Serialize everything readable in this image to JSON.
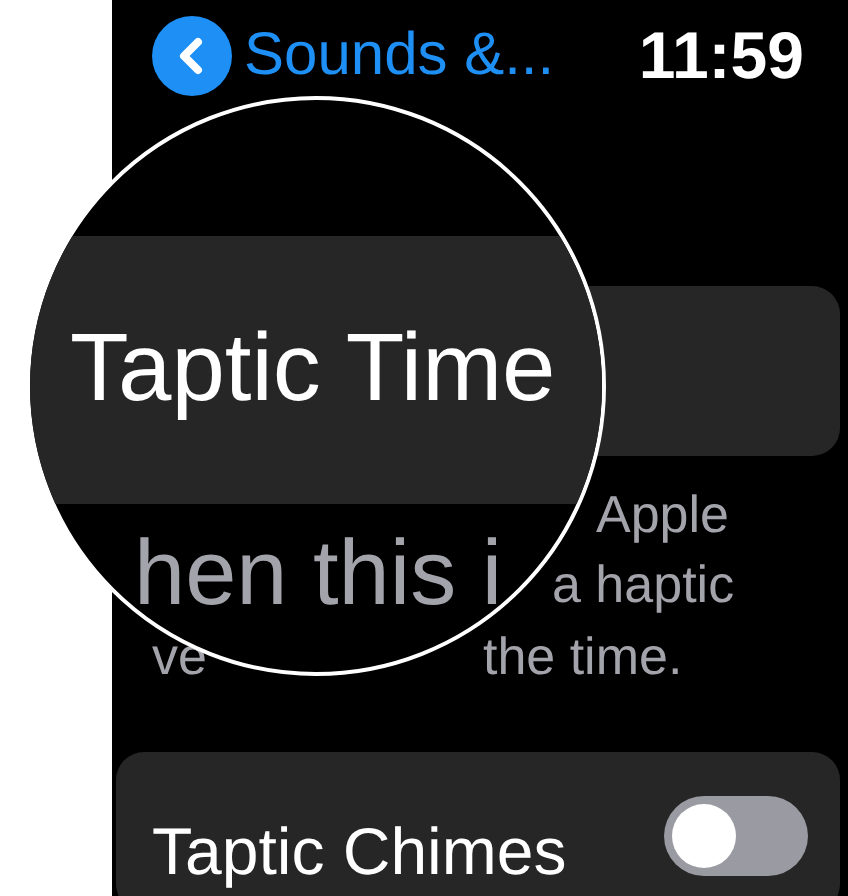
{
  "header": {
    "back_label": "Sounds &...",
    "time": "11:59"
  },
  "description": {
    "lines": [
      "Apple",
      "a haptic"
    ],
    "last_line_start": "ve",
    "last_line_end": "the time."
  },
  "rows": [
    {
      "label": "Taptic Chimes",
      "kind": "toggle",
      "on": false
    }
  ],
  "magnifier": {
    "title": "Taptic Time",
    "description": "hen this i"
  }
}
